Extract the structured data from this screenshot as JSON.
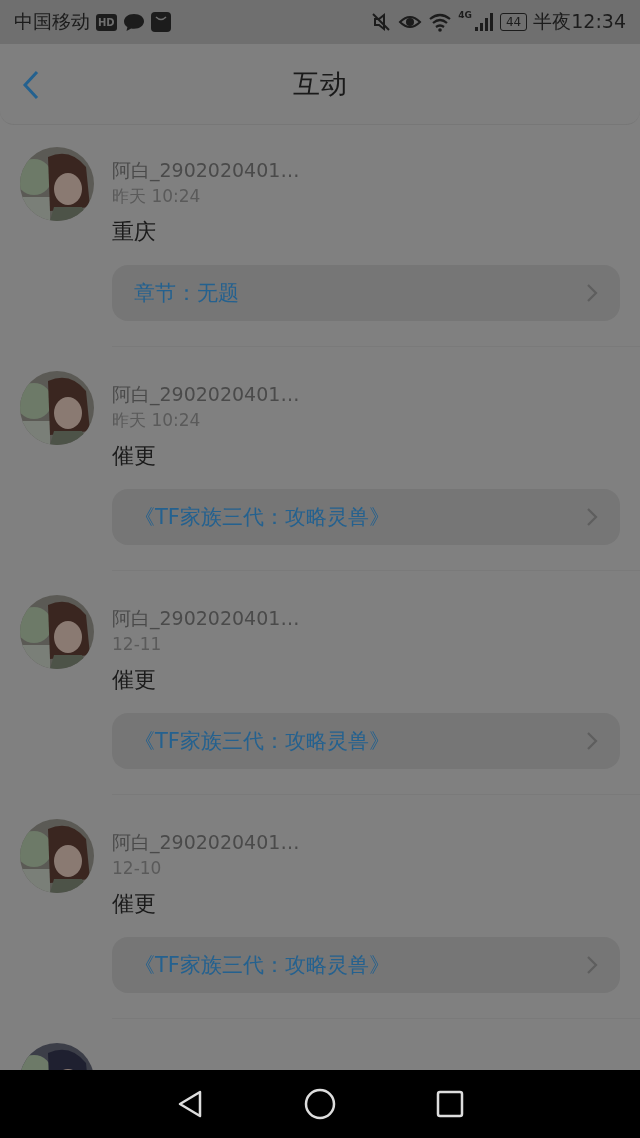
{
  "status_bar": {
    "carrier": "中国移动",
    "hd_badge": "HD",
    "network": "4G",
    "battery": "44",
    "time": "半夜12:34"
  },
  "header": {
    "title": "互动"
  },
  "items": [
    {
      "name": "阿白_2902020401…",
      "time": "昨天 10:24",
      "content": "重庆",
      "link": "章节：无题",
      "avatar": {
        "kind": "picture"
      }
    },
    {
      "name": "阿白_2902020401…",
      "time": "昨天 10:24",
      "content": "催更",
      "link": "《TF家族三代：攻略灵兽》",
      "avatar": {
        "kind": "picture"
      }
    },
    {
      "name": "阿白_2902020401…",
      "time": "12-11",
      "content": "催更",
      "link": "《TF家族三代：攻略灵兽》",
      "avatar": {
        "kind": "picture"
      }
    },
    {
      "name": "阿白_2902020401…",
      "time": "12-10",
      "content": "催更",
      "link": "《TF家族三代：攻略灵兽》",
      "avatar": {
        "kind": "picture"
      }
    },
    {
      "avatar": {
        "kind": "picture"
      }
    }
  ]
}
